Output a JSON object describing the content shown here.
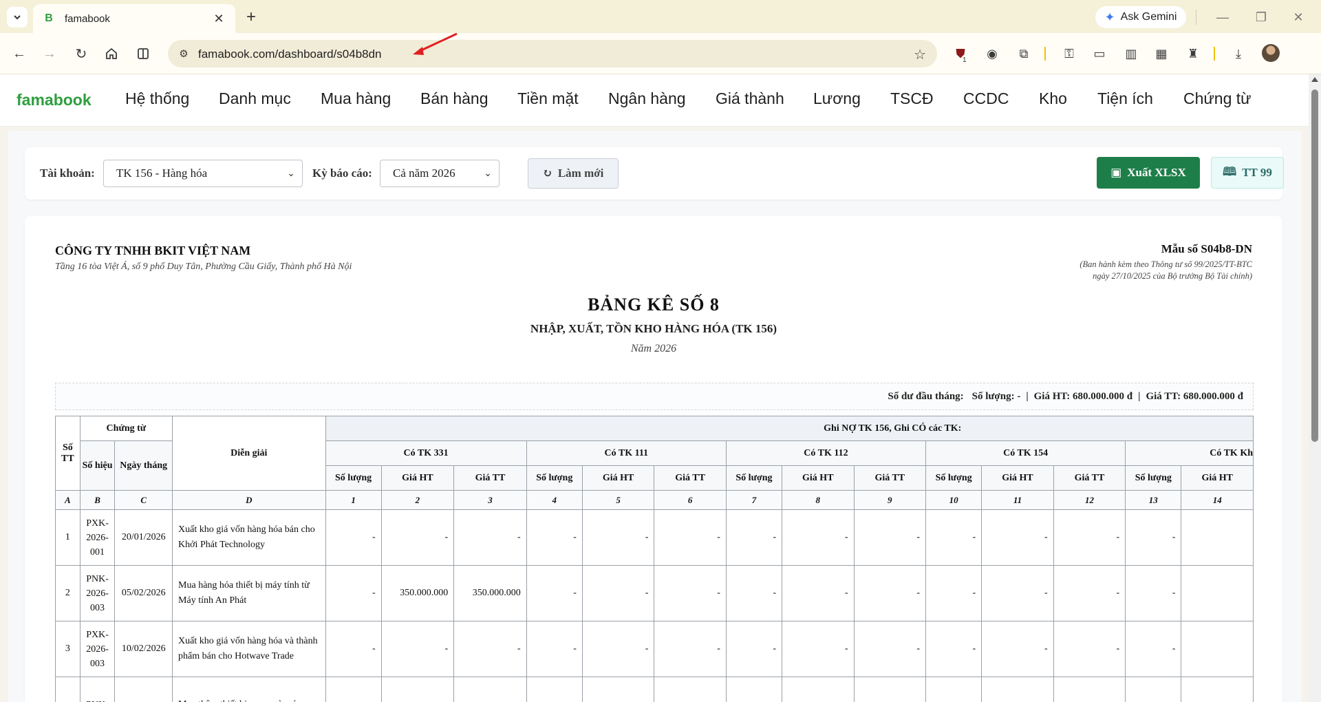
{
  "browser": {
    "tab_title": "famabook",
    "favicon_letter": "B",
    "url": "famabook.com/dashboard/s04b8dn",
    "gemini_label": "Ask Gemini",
    "extension_badge": "1"
  },
  "app": {
    "brand": "famabook",
    "menu": [
      "Hệ thống",
      "Danh mục",
      "Mua hàng",
      "Bán hàng",
      "Tiền mặt",
      "Ngân hàng",
      "Giá thành",
      "Lương",
      "TSCĐ",
      "CCDC",
      "Kho",
      "Tiện ích",
      "Chứng từ"
    ]
  },
  "filters": {
    "account_label": "Tài khoản:",
    "account_value": "TK 156 - Hàng hóa",
    "period_label": "Kỳ báo cáo:",
    "period_value": "Cả năm 2026",
    "refresh_label": "Làm mới",
    "export_label": "Xuất XLSX",
    "tt_label": "TT 99"
  },
  "report": {
    "company": "CÔNG TY TNHH BKIT VIỆT NAM",
    "address": "Tầng 16 tòa Việt Á, số 9 phố Duy Tân, Phường Cầu Giấy, Thành phố Hà Nội",
    "form_no": "Mẫu số S04b8-DN",
    "issued_line1": "(Ban hành kèm theo Thông tư số 99/2025/TT-BTC",
    "issued_line2": "ngày 27/10/2025 của Bộ trưởng Bộ Tài chính)",
    "title": "BẢNG KÊ SỐ 8",
    "subtitle": "NHẬP, XUẤT, TỒN KHO HÀNG HÓA (TK 156)",
    "year": "Năm 2026",
    "opening": {
      "label": "Số dư đầu tháng:",
      "qty": "Số lượng: -",
      "ht": "Giá HT: 680.000.000 đ",
      "tt": "Giá TT: 680.000.000 đ",
      "sep": "|"
    }
  },
  "table": {
    "h_stt": "Số TT",
    "h_chungtu": "Chứng từ",
    "h_sohieu": "Số hiệu",
    "h_ngay": "Ngày tháng",
    "h_diengiai": "Diễn giải",
    "h_ghino": "Ghi NỢ TK 156, Ghi CÓ các TK:",
    "groups": [
      "Có TK 331",
      "Có TK 111",
      "Có TK 112",
      "Có TK 154",
      "Có TK Kh"
    ],
    "h_soluong": "Số lượng",
    "h_giaht": "Giá HT",
    "h_giatt": "Giá TT",
    "codes": [
      "A",
      "B",
      "C",
      "D",
      "1",
      "2",
      "3",
      "4",
      "5",
      "6",
      "7",
      "8",
      "9",
      "10",
      "11",
      "12",
      "13",
      "14"
    ],
    "rows": [
      {
        "stt": "1",
        "so": [
          "PXK-",
          "2026-",
          "001"
        ],
        "ngay": "20/01/2026",
        "desc": "Xuất kho giá vốn hàng hóa bán cho Khởi Phát Technology",
        "vals": [
          "-",
          "-",
          "-",
          "-",
          "-",
          "-",
          "-",
          "-",
          "-",
          "-",
          "-",
          "-",
          "-",
          ""
        ]
      },
      {
        "stt": "2",
        "so": [
          "PNK-",
          "2026-",
          "003"
        ],
        "ngay": "05/02/2026",
        "desc": "Mua hàng hóa thiết bị máy tính từ Máy tính An Phát",
        "vals": [
          "-",
          "350.000.000",
          "350.000.000",
          "-",
          "-",
          "-",
          "-",
          "-",
          "-",
          "-",
          "-",
          "-",
          "-",
          ""
        ]
      },
      {
        "stt": "3",
        "so": [
          "PXK-",
          "2026-",
          "003"
        ],
        "ngay": "10/02/2026",
        "desc": "Xuất kho giá vốn hàng hóa và thành phẩm bán cho Hotwave Trade",
        "vals": [
          "-",
          "-",
          "-",
          "-",
          "-",
          "-",
          "-",
          "-",
          "-",
          "-",
          "-",
          "-",
          "-",
          ""
        ]
      },
      {
        "stt": "",
        "so": [
          "PNK-",
          "",
          ""
        ],
        "ngay": "",
        "desc": "Mua thêm thiết bị mạng và máy",
        "vals": [
          "",
          "",
          "",
          "",
          "",
          "",
          "",
          "",
          "",
          "",
          "",
          "",
          "",
          ""
        ]
      }
    ]
  }
}
